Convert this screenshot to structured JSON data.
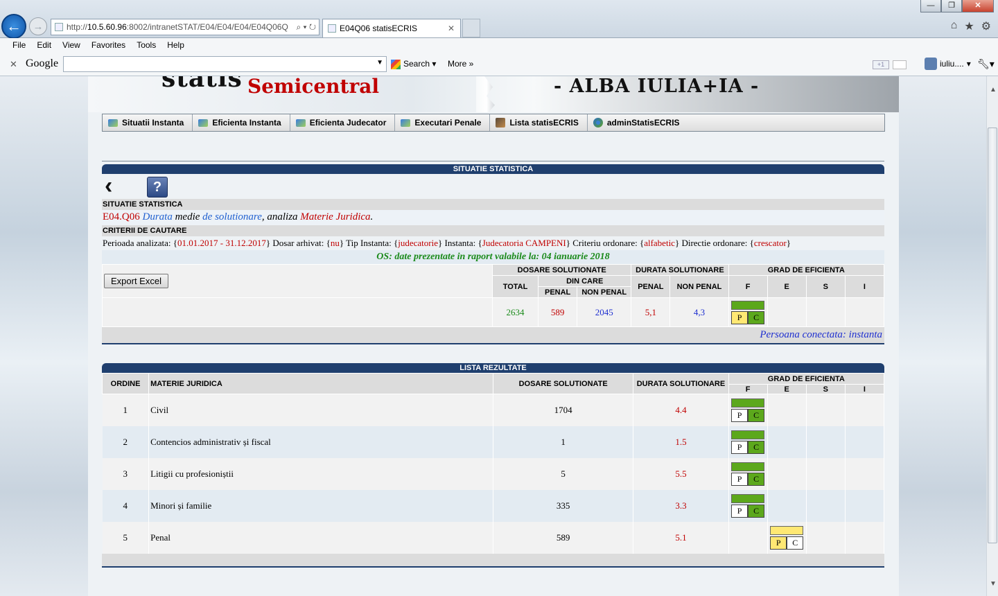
{
  "browser": {
    "url_prefix": "http://",
    "url_host": "10.5.60.96",
    "url_rest": ":8002/intranetSTAT/E04/E04/E04/E04Q06Q",
    "tab_title": "E04Q06 statisECRIS",
    "menu": [
      "File",
      "Edit",
      "View",
      "Favorites",
      "Tools",
      "Help"
    ],
    "google_logo": "Google",
    "search_label": "Search",
    "more_label": "More",
    "user_label": "iuliu...."
  },
  "banner": {
    "statis": "statis",
    "semicentral": "Semicentral",
    "city": "- ALBA IULIA+IA -"
  },
  "nav": [
    {
      "label": "Situatii Instanta",
      "icon": "report-icon"
    },
    {
      "label": "Eficienta Instanta",
      "icon": "report-icon"
    },
    {
      "label": "Eficienta Judecator",
      "icon": "report-icon"
    },
    {
      "label": "Executari Penale",
      "icon": "report-icon"
    },
    {
      "label": "Lista statisECRIS",
      "icon": "gavel-icon"
    },
    {
      "label": "adminStatisECRIS",
      "icon": "admin-icon"
    }
  ],
  "situatie": {
    "header": "SITUATIE STATISTICA",
    "subheader": "SITUATIE STATISTICA",
    "code": "E04.Q06",
    "w1": "Durata",
    "w2": "medie",
    "w3": "de solutionare",
    "w4": ", analiza",
    "w5": "Materie Juridica",
    "w6": ".",
    "criteria_header": "CRITERII DE CAUTARE",
    "criteria": [
      {
        "label": "Perioada analizata: {",
        "value": "01.01.2017 - 31.12.2017",
        "end": "}"
      },
      {
        "label": " Dosar arhivat: {",
        "value": "nu",
        "end": "}"
      },
      {
        "label": " Tip Instanta: {",
        "value": "judecatorie",
        "end": "}"
      },
      {
        "label": " Instanta: {",
        "value": "Judecatoria CAMPENI",
        "end": "}"
      },
      {
        "label": " Criteriu ordonare: {",
        "value": "alfabetic",
        "end": "}"
      },
      {
        "label": " Directie ordonare: {",
        "value": "crescator",
        "end": "}"
      }
    ],
    "os_note": "OS: date prezentate in raport valabile la: 04 ianuarie 2018",
    "export_label": "Export Excel",
    "col_dosare": "DOSARE SOLUTIONATE",
    "col_din_care": "DIN CARE",
    "col_total": "TOTAL",
    "col_penal": "PENAL",
    "col_non_penal": "NON PENAL",
    "col_durata": "DURATA SOLUTIONARE",
    "col_grad": "GRAD DE EFICIENTA",
    "grad_cols": [
      "F",
      "E",
      "S",
      "I"
    ],
    "total": "2634",
    "penal": "589",
    "non_penal": "2045",
    "durata_penal": "5,1",
    "durata_non_penal": "4,3",
    "pc_p": "P",
    "pc_c": "C",
    "persoana": "Persoana conectata: instanta"
  },
  "lista": {
    "header": "LISTA REZULTATE",
    "col_ordine": "ORDINE",
    "col_materie": "MATERIE JURIDICA",
    "col_dosare": "DOSARE SOLUTIONATE",
    "col_durata": "DURATA SOLUTIONARE",
    "col_grad": "GRAD DE EFICIENTA",
    "grad_cols": [
      "F",
      "E",
      "S",
      "I"
    ],
    "rows": [
      {
        "ordine": "1",
        "materie": "Civil",
        "dosare": "1704",
        "durata": "4.4",
        "grad": "F"
      },
      {
        "ordine": "2",
        "materie": "Contencios administrativ și fiscal",
        "dosare": "1",
        "durata": "1.5",
        "grad": "F"
      },
      {
        "ordine": "3",
        "materie": "Litigii cu profesioniștii",
        "dosare": "5",
        "durata": "5.5",
        "grad": "F"
      },
      {
        "ordine": "4",
        "materie": "Minori și familie",
        "dosare": "335",
        "durata": "3.3",
        "grad": "F"
      },
      {
        "ordine": "5",
        "materie": "Penal",
        "dosare": "589",
        "durata": "5.1",
        "grad": "E"
      }
    ]
  },
  "colors": {
    "green": "#5ca81c",
    "yellow": "#ffe873",
    "navy": "#1f3f6e",
    "red": "#c00000"
  }
}
